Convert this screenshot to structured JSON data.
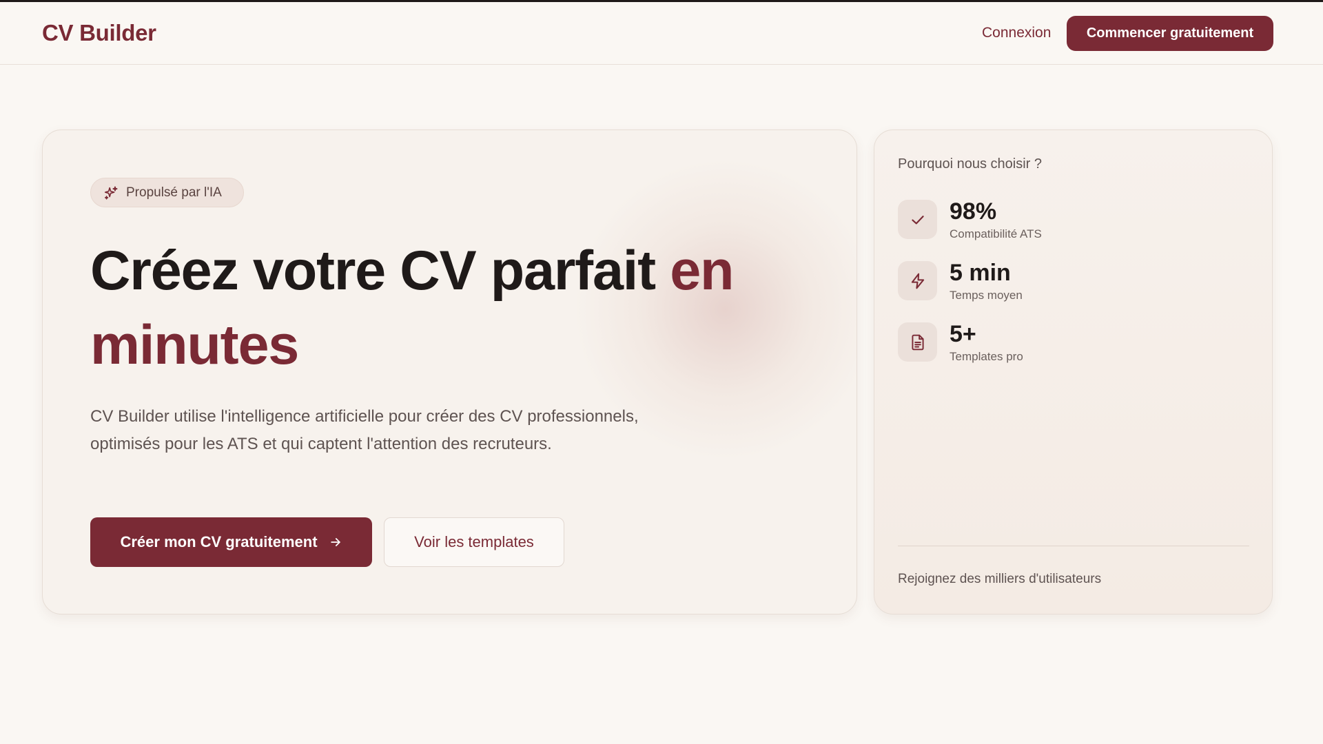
{
  "header": {
    "logo": "CV Builder",
    "login_label": "Connexion",
    "cta_label": "Commencer gratuitement"
  },
  "hero": {
    "badge_label": "Propulsé par l'IA",
    "badge_icon": "sparkles-icon",
    "headline_main": "Créez votre CV parfait ",
    "headline_accent": "en minutes",
    "description": "CV Builder utilise l'intelligence artificielle pour créer des CV professionnels, optimisés pour les ATS et qui captent l'attention des recruteurs.",
    "primary_button": "Créer mon CV gratuitement",
    "primary_button_icon": "arrow-right-icon",
    "secondary_button": "Voir les templates"
  },
  "side": {
    "title": "Pourquoi nous choisir ?",
    "stats": [
      {
        "value": "98%",
        "label": "Compatibilité ATS",
        "icon": "check-icon"
      },
      {
        "value": "5 min",
        "label": "Temps moyen",
        "icon": "lightning-icon"
      },
      {
        "value": "5+",
        "label": "Templates pro",
        "icon": "document-icon"
      }
    ],
    "footer": "Rejoignez des milliers d'utilisateurs"
  },
  "colors": {
    "accent": "#7a2a35",
    "background": "#faf7f3",
    "text": "#1f1a19",
    "muted": "#5e5351"
  }
}
